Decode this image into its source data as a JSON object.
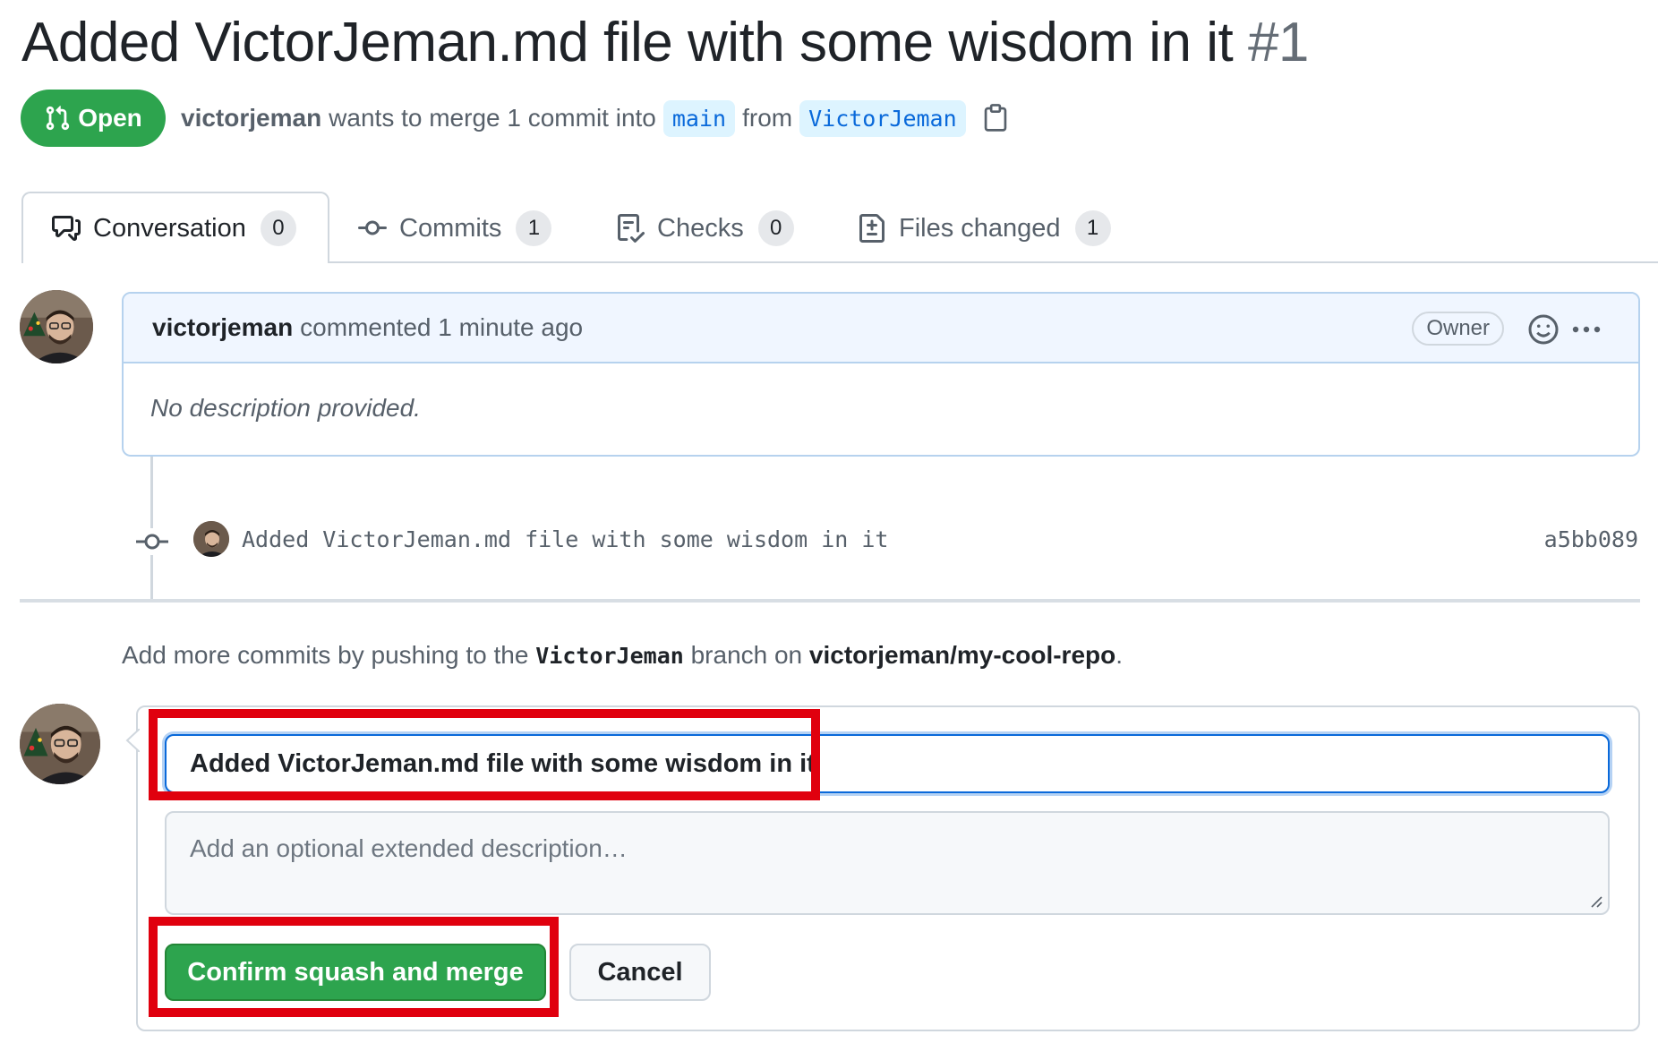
{
  "pr": {
    "title": "Added VictorJeman.md file with some wisdom in it",
    "number": "#1",
    "state": "Open",
    "author": "victorjeman",
    "merge_text": "wants to merge 1 commit into",
    "base_branch": "main",
    "from_text": "from",
    "head_branch": "VictorJeman"
  },
  "tabs": [
    {
      "label": "Conversation",
      "count": "0",
      "icon": "comment-discussion-icon"
    },
    {
      "label": "Commits",
      "count": "1",
      "icon": "commit-icon"
    },
    {
      "label": "Checks",
      "count": "0",
      "icon": "checklist-icon"
    },
    {
      "label": "Files changed",
      "count": "1",
      "icon": "file-diff-icon"
    }
  ],
  "comment": {
    "author": "victorjeman",
    "action": "commented 1 minute ago",
    "badge": "Owner",
    "body": "No description provided."
  },
  "commit": {
    "message": "Added VictorJeman.md file with some wisdom in it",
    "sha": "a5bb089"
  },
  "hint": {
    "prefix": "Add more commits by pushing to the",
    "branch": "VictorJeman",
    "middle": "branch on",
    "repo": "victorjeman/my-cool-repo",
    "suffix": "."
  },
  "merge": {
    "title_value": "Added VictorJeman.md file with some wisdom in it",
    "description_placeholder": "Add an optional extended description…",
    "confirm_label": "Confirm squash and merge",
    "cancel_label": "Cancel"
  },
  "colors": {
    "open_green": "#2da44e",
    "branch_blue": "#0969da",
    "highlight_red": "#e0000e"
  }
}
